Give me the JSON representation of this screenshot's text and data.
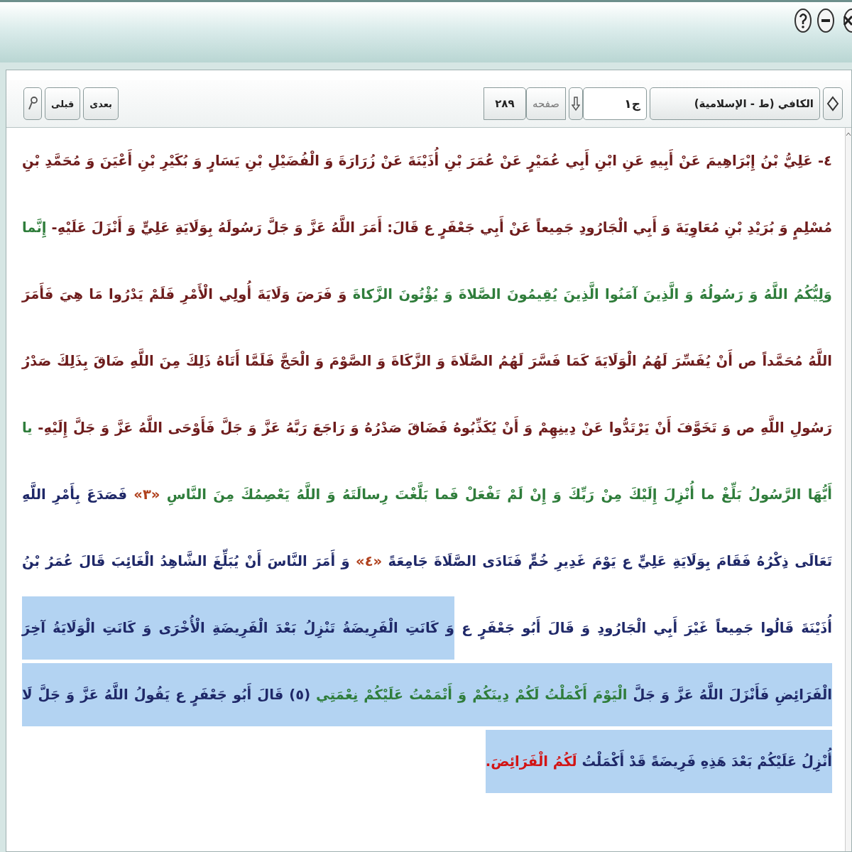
{
  "toolbar": {
    "book": "الكافي (ط - الإسلامية)",
    "volume": "ج١",
    "page_label": "صفحه",
    "page": "٢٨٩",
    "buttons": [
      "بعدى",
      "قبلى"
    ]
  },
  "text": {
    "segments": [
      {
        "kind": "chain",
        "selected": false,
        "text": "٤- عَلِيُّ بْنُ إِبْرَاهِيمَ عَنْ أَبِيهِ عَنِ ابْنِ أَبِي عُمَيْرٍ عَنْ عُمَرَ بْنِ أُذَيْنَةَ عَنْ زُرَارَةَ وَ الْفُضَيْلِ بْنِ يَسَارٍ وَ بُكَيْرِ بْنِ أَعْيَنَ وَ مُحَمَّدِ بْنِ مُسْلِمٍ وَ بُرَيْدِ بْنِ مُعَاوِيَةَ وَ أَبِي الْجَارُودِ جَمِيعاً عَنْ أَبِي جَعْفَرٍ ع قَالَ: أَمَرَ اللَّهُ عَزَّ وَ جَلَّ رَسُولَهُ بِوَلَايَةِ عَلِيٍّ وَ أَنْزَلَ عَلَيْهِ- "
      },
      {
        "kind": "quran",
        "selected": false,
        "text": "إِنَّما وَلِيُّكُمُ اللَّهُ وَ رَسُولُهُ وَ الَّذِينَ آمَنُوا الَّذِينَ يُقِيمُونَ الصَّلاةَ وَ يُؤْتُونَ الزَّكاةَ "
      },
      {
        "kind": "chain",
        "selected": false,
        "text": "وَ فَرَضَ وَلَايَةَ أُولِي الْأَمْرِ فَلَمْ يَدْرُوا مَا هِيَ فَأَمَرَ اللَّهُ مُحَمَّداً ص أَنْ يُفَسِّرَ لَهُمُ الْوَلَايَةَ كَمَا فَسَّرَ لَهُمُ الصَّلَاةَ وَ الزَّكَاةَ وَ الصَّوْمَ وَ الْحَجَّ فَلَمَّا أَتَاهُ ذَلِكَ مِنَ اللَّهِ ضَاقَ بِذَلِكَ صَدْرُ رَسُولِ اللَّهِ ص وَ تَخَوَّفَ أَنْ يَرْتَدُّوا عَنْ دِينِهِمْ وَ أَنْ يُكَذِّبُوهُ فَضَاقَ صَدْرُهُ وَ رَاجَعَ رَبَّهُ عَزَّ وَ جَلَّ فَأَوْحَى اللَّهُ عَزَّ وَ جَلَّ إِلَيْهِ- "
      },
      {
        "kind": "quran",
        "selected": false,
        "text": "يا أَيُّهَا الرَّسُولُ بَلِّغْ ما أُنْزِلَ إِلَيْكَ مِنْ رَبِّكَ وَ إِنْ لَمْ تَفْعَلْ فَما بَلَّغْتَ رِسالَتَهُ وَ اللَّهُ يَعْصِمُكَ مِنَ النَّاسِ "
      },
      {
        "kind": "note",
        "selected": false,
        "text": "«٣» "
      },
      {
        "kind": "plain",
        "selected": false,
        "text": "فَصَدَعَ بِأَمْرِ اللَّهِ تَعَالَى ذِكْرُهُ فَقَامَ بِوَلَايَةِ عَلِيٍّ ع يَوْمَ غَدِيرِ خُمٍّ فَنَادَى الصَّلَاةَ جَامِعَةً "
      },
      {
        "kind": "note",
        "selected": false,
        "text": "«٤» "
      },
      {
        "kind": "plain",
        "selected": false,
        "text": "وَ أَمَرَ النَّاسَ أَنْ يُبَلِّغَ الشَّاهِدُ الْغَائِبَ قَالَ عُمَرُ بْنُ أُذَيْنَةَ قَالُوا جَمِيعاً غَيْرَ أَبِي الْجَارُودِ وَ قَالَ أَبُو جَعْفَرٍ ع "
      },
      {
        "kind": "plain",
        "selected": true,
        "text": "وَ كَانَتِ الْفَرِيضَةُ تَنْزِلُ بَعْدَ الْفَرِيضَةِ الْأُخْرَى وَ كَانَتِ الْوَلَايَةُ آخِرَ الْفَرَائِضِ فَأَنْزَلَ اللَّهُ عَزَّ وَ جَلَّ "
      },
      {
        "kind": "quran",
        "selected": true,
        "text": "الْيَوْمَ أَكْمَلْتُ لَكُمْ دِينَكُمْ وَ أَتْمَمْتُ عَلَيْكُمْ نِعْمَتِي "
      },
      {
        "kind": "plain",
        "selected": true,
        "text": "(٥) قَالَ أَبُو جَعْفَرٍ ع يَقُولُ اللَّهُ عَزَّ وَ جَلَّ لَا أُنْزِلُ عَلَيْكُمْ بَعْدَ هَذِهِ فَرِيضَةً قَدْ أَكْمَلْتُ "
      },
      {
        "kind": "emphasis",
        "selected": true,
        "text": "لَكُمُ الْفَرَائِضَ."
      }
    ]
  }
}
